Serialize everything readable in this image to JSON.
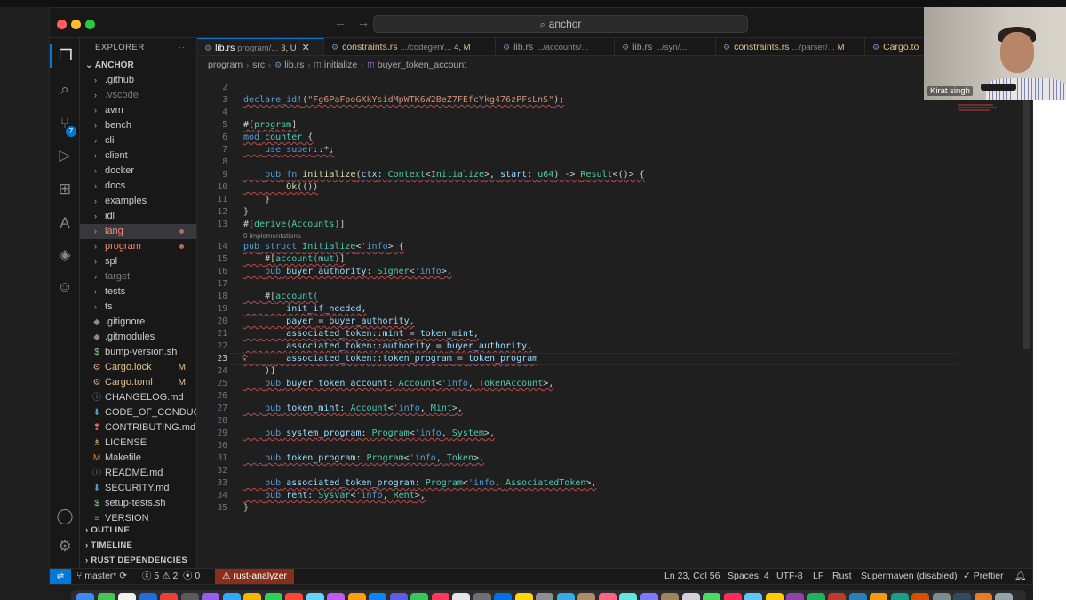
{
  "titlebar": {
    "search": "anchor"
  },
  "sidebar": {
    "header": "EXPLORER",
    "root": "ANCHOR",
    "items": [
      {
        "label": ".github",
        "type": "folder",
        "style": "normal",
        "status": ""
      },
      {
        "label": ".vscode",
        "type": "folder",
        "style": "dim",
        "status": ""
      },
      {
        "label": "avm",
        "type": "folder",
        "style": "normal",
        "status": ""
      },
      {
        "label": "bench",
        "type": "folder",
        "style": "normal",
        "status": ""
      },
      {
        "label": "cli",
        "type": "folder",
        "style": "normal",
        "status": ""
      },
      {
        "label": "client",
        "type": "folder",
        "style": "normal",
        "status": ""
      },
      {
        "label": "docker",
        "type": "folder",
        "style": "normal",
        "status": ""
      },
      {
        "label": "docs",
        "type": "folder",
        "style": "normal",
        "status": ""
      },
      {
        "label": "examples",
        "type": "folder",
        "style": "normal",
        "status": ""
      },
      {
        "label": "idl",
        "type": "folder",
        "style": "normal",
        "status": ""
      },
      {
        "label": "lang",
        "type": "folder",
        "style": "err",
        "status": "dot",
        "selected": true
      },
      {
        "label": "program",
        "type": "folder",
        "style": "err",
        "status": "dot"
      },
      {
        "label": "spl",
        "type": "folder",
        "style": "normal",
        "status": ""
      },
      {
        "label": "target",
        "type": "folder",
        "style": "dim",
        "status": ""
      },
      {
        "label": "tests",
        "type": "folder",
        "style": "normal",
        "status": ""
      },
      {
        "label": "ts",
        "type": "folder",
        "style": "normal",
        "status": ""
      },
      {
        "label": ".gitignore",
        "type": "file",
        "icon": "◆",
        "iconColor": "#8a8a8a",
        "style": "normal",
        "status": ""
      },
      {
        "label": ".gitmodules",
        "type": "file",
        "icon": "◆",
        "iconColor": "#8a8a8a",
        "style": "normal",
        "status": ""
      },
      {
        "label": "bump-version.sh",
        "type": "file",
        "icon": "$",
        "iconColor": "#89d185",
        "style": "normal",
        "status": ""
      },
      {
        "label": "Cargo.lock",
        "type": "file",
        "icon": "⚙",
        "iconColor": "#dea584",
        "style": "mod",
        "status": "M"
      },
      {
        "label": "Cargo.toml",
        "type": "file",
        "icon": "⚙",
        "iconColor": "#dea584",
        "style": "mod",
        "status": "M"
      },
      {
        "label": "CHANGELOG.md",
        "type": "file",
        "icon": "ⓘ",
        "iconColor": "#519aba",
        "style": "normal",
        "status": ""
      },
      {
        "label": "CODE_OF_CONDUC...",
        "type": "file",
        "icon": "⬇",
        "iconColor": "#519aba",
        "style": "normal",
        "status": ""
      },
      {
        "label": "CONTRIBUTING.md",
        "type": "file",
        "icon": "❢",
        "iconColor": "#d16969",
        "style": "normal",
        "status": ""
      },
      {
        "label": "LICENSE",
        "type": "file",
        "icon": "♗",
        "iconColor": "#e5c07b",
        "style": "normal",
        "status": ""
      },
      {
        "label": "Makefile",
        "type": "file",
        "icon": "M",
        "iconColor": "#e37933",
        "style": "normal",
        "status": ""
      },
      {
        "label": "README.md",
        "type": "file",
        "icon": "ⓘ",
        "iconColor": "#519aba",
        "style": "normal",
        "status": ""
      },
      {
        "label": "SECURITY.md",
        "type": "file",
        "icon": "⬇",
        "iconColor": "#519aba",
        "style": "normal",
        "status": ""
      },
      {
        "label": "setup-tests.sh",
        "type": "file",
        "icon": "$",
        "iconColor": "#89d185",
        "style": "normal",
        "status": ""
      },
      {
        "label": "VERSION",
        "type": "file",
        "icon": "≡",
        "iconColor": "#8a8a8a",
        "style": "normal",
        "status": ""
      }
    ],
    "sections": [
      "OUTLINE",
      "TIMELINE",
      "RUST DEPENDENCIES"
    ]
  },
  "activity": {
    "source_control_badge": "7"
  },
  "tabs": [
    {
      "name": "lib.rs",
      "desc": "program/...",
      "meta": "3, U",
      "active": true,
      "close": "✕"
    },
    {
      "name": "constraints.rs",
      "desc": ".../codegen/...",
      "meta": "4, M",
      "active": false,
      "close": ""
    },
    {
      "name": "lib.rs",
      "desc": ".../accounts/...",
      "meta": "",
      "active": false,
      "close": ""
    },
    {
      "name": "lib.rs",
      "desc": ".../syn/...",
      "meta": "",
      "active": false,
      "close": ""
    },
    {
      "name": "constraints.rs",
      "desc": ".../parser/...",
      "meta": "M",
      "active": false,
      "close": ""
    },
    {
      "name": "Cargo.to",
      "desc": "",
      "meta": "",
      "active": false,
      "close": ""
    }
  ],
  "breadcrumb": [
    "program",
    "src",
    "lib.rs",
    "initialize",
    "buyer_token_account"
  ],
  "editor": {
    "codelens": "0 implementations",
    "lines": [
      {
        "n": "2",
        "text": ""
      },
      {
        "n": "3",
        "text": "declare_id!(\"Fg6PaFpoGXkYsidMpWTK6W2BeZ7FEfcYkg476zPFsLnS\");"
      },
      {
        "n": "4",
        "text": ""
      },
      {
        "n": "5",
        "text": "#[program]"
      },
      {
        "n": "6",
        "text": "mod counter {"
      },
      {
        "n": "7",
        "text": "    use super::*;"
      },
      {
        "n": "8",
        "text": ""
      },
      {
        "n": "9",
        "text": "    pub fn initialize(ctx: Context<Initialize>, start: u64) -> Result<()> {"
      },
      {
        "n": "10",
        "text": "        Ok(())"
      },
      {
        "n": "11",
        "text": "    }"
      },
      {
        "n": "12",
        "text": "}"
      },
      {
        "n": "13",
        "text": "#[derive(Accounts)]"
      },
      {
        "n": "14",
        "text": "pub struct Initialize<'info> {"
      },
      {
        "n": "15",
        "text": "    #[account(mut)]"
      },
      {
        "n": "16",
        "text": "    pub buyer_authority: Signer<'info>,"
      },
      {
        "n": "17",
        "text": ""
      },
      {
        "n": "18",
        "text": "    #[account("
      },
      {
        "n": "19",
        "text": "        init_if_needed,"
      },
      {
        "n": "20",
        "text": "        payer = buyer_authority,"
      },
      {
        "n": "21",
        "text": "        associated_token::mint = token_mint,"
      },
      {
        "n": "22",
        "text": "        associated_token::authority = buyer_authority,"
      },
      {
        "n": "23",
        "text": "        associated_token::token_program = token_program"
      },
      {
        "n": "24",
        "text": "    )]"
      },
      {
        "n": "25",
        "text": "    pub buyer_token_account: Account<'info, TokenAccount>,"
      },
      {
        "n": "26",
        "text": ""
      },
      {
        "n": "27",
        "text": "    pub token_mint: Account<'info, Mint>,"
      },
      {
        "n": "28",
        "text": ""
      },
      {
        "n": "29",
        "text": "    pub system_program: Program<'info, System>,"
      },
      {
        "n": "30",
        "text": ""
      },
      {
        "n": "31",
        "text": "    pub token_program: Program<'info, Token>,"
      },
      {
        "n": "32",
        "text": ""
      },
      {
        "n": "33",
        "text": "    pub associated_token_program: Program<'info, AssociatedToken>,"
      },
      {
        "n": "34",
        "text": "    pub rent: Sysvar<'info, Rent>,"
      },
      {
        "n": "35",
        "text": "}"
      }
    ],
    "current_line": "23"
  },
  "statusbar": {
    "branch": "master*",
    "errors": "5",
    "warnings": "2",
    "ports": "0",
    "rust_analyzer": "rust-analyzer",
    "position": "Ln 23, Col 56",
    "spaces": "Spaces: 4",
    "encoding": "UTF-8",
    "eol": "LF",
    "language": "Rust",
    "supermaven": "Supermaven (disabled)",
    "prettier": "Prettier"
  },
  "webcam": {
    "name": "Kirat singh"
  },
  "colors": {
    "accent": "#0078d4",
    "keyword": "#c586c0",
    "function": "#dcdcaa",
    "type": "#4ec9b0",
    "string": "#ce9178",
    "variable": "#9cdcfe",
    "macro": "#569cd6"
  }
}
